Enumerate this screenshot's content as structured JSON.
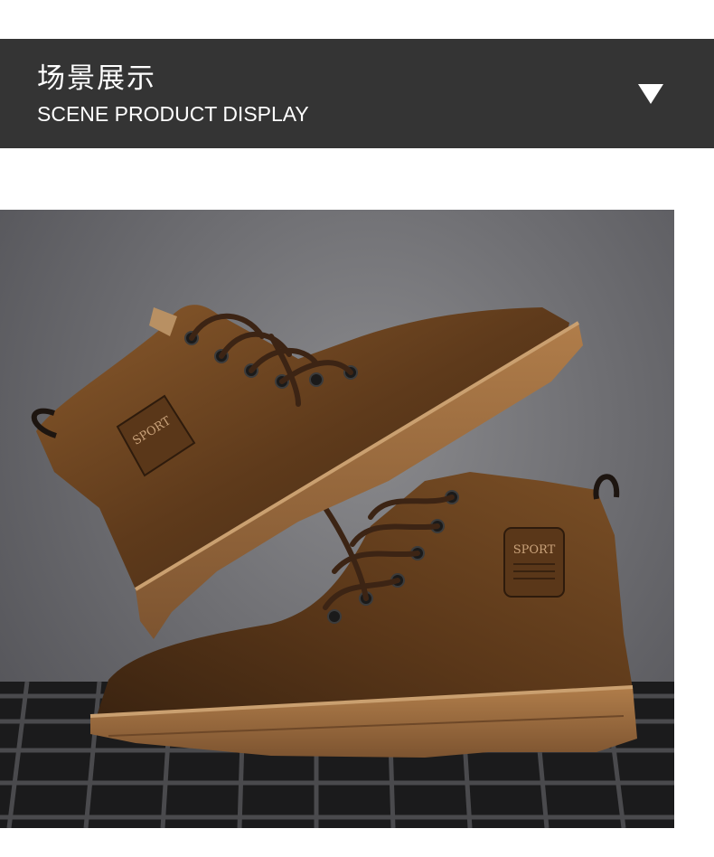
{
  "section": {
    "title_cn": "场景展示",
    "title_en": "SCENE PRODUCT DISPLAY",
    "arrow_icon": "triangle-down-icon"
  },
  "product_image": {
    "subject": "brown-leather-lace-up-boots-icon",
    "patch_text_top_boot": "SPORT",
    "patch_text_bottom_boot": "SPORT"
  },
  "colors": {
    "banner_bg": "#343434",
    "banner_text": "#ffffff",
    "leather": "#6b4220",
    "sole": "#9a6b3e"
  }
}
